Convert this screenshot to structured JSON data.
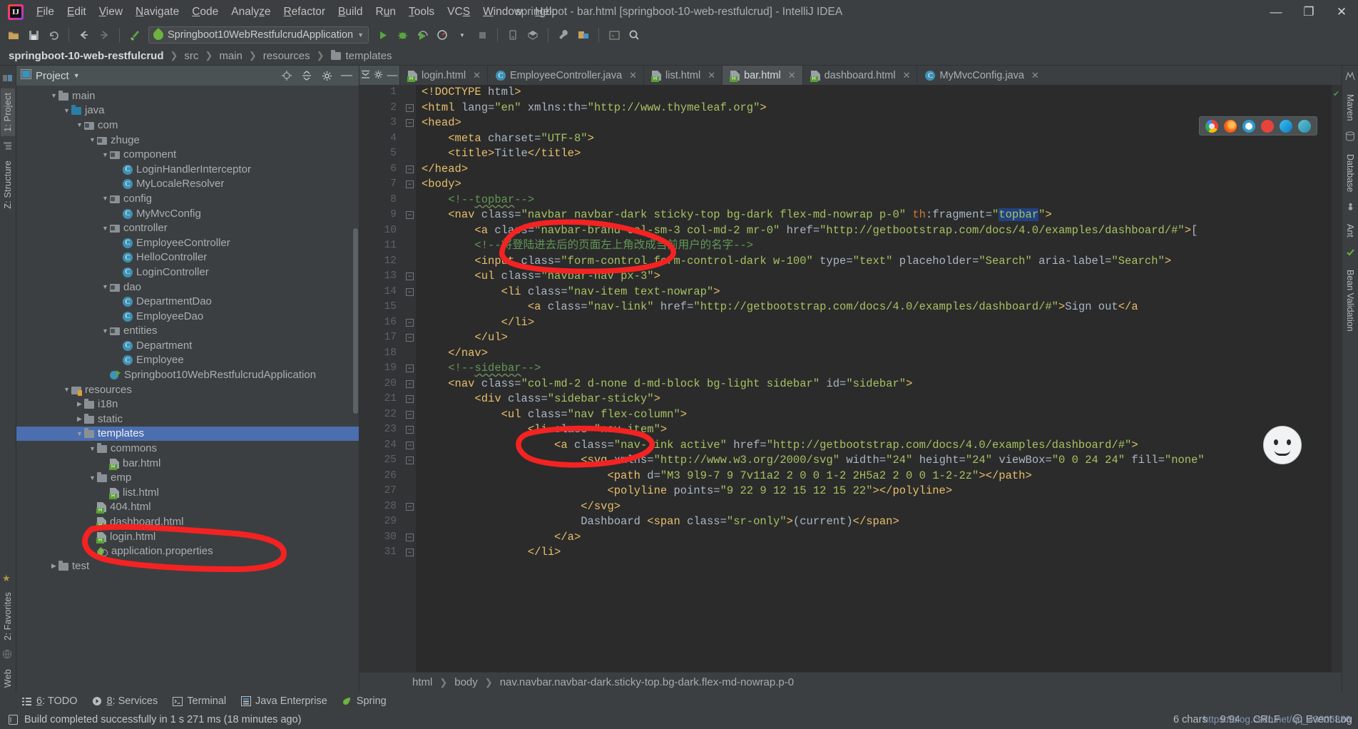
{
  "window": {
    "title": "springboot - bar.html [springboot-10-web-restfulcrud] - IntelliJ IDEA",
    "minimize": "—",
    "maximize": "❐",
    "close": "✕"
  },
  "menu": [
    "File",
    "Edit",
    "View",
    "Navigate",
    "Code",
    "Analyze",
    "Refactor",
    "Build",
    "Run",
    "Tools",
    "VCS",
    "Window",
    "Help"
  ],
  "toolbar": {
    "run_config": "Springboot10WebRestfulcrudApplication",
    "icons": [
      "open-folder-icon",
      "save-icon",
      "sync-icon",
      "back-icon",
      "forward-icon",
      "build-icon",
      "run-icon",
      "debug-icon",
      "coverage-icon",
      "profile-icon",
      "stop-icon",
      "device-manager-icon",
      "sdk-manager-icon",
      "settings-wrench-icon",
      "project-structure-icon",
      "terminal-icon",
      "search-everywhere-icon"
    ]
  },
  "breadcrumb": {
    "project": "springboot-10-web-restfulcrud",
    "items": [
      "src",
      "main",
      "resources"
    ],
    "current": "templates"
  },
  "left_strip": {
    "project_tab": "1: Project",
    "structure_tab": "Z: Structure",
    "favorites_tab": "2: Favorites",
    "web_tab": "Web"
  },
  "right_strip": {
    "maven_tab": "Maven",
    "database_tab": "Database",
    "ant_tab": "Ant",
    "bean_validation_tab": "Bean Validation"
  },
  "project_panel": {
    "title": "Project",
    "header_icons": [
      "locate-icon",
      "collapse-all-icon",
      "gear-icon",
      "hide-icon"
    ],
    "tree": [
      {
        "label": "main",
        "indent": 2,
        "arrow": "down",
        "icon": "folder"
      },
      {
        "label": "java",
        "indent": 3,
        "arrow": "down",
        "icon": "folder-blue"
      },
      {
        "label": "com",
        "indent": 4,
        "arrow": "down",
        "icon": "package"
      },
      {
        "label": "zhuge",
        "indent": 5,
        "arrow": "down",
        "icon": "package"
      },
      {
        "label": "component",
        "indent": 6,
        "arrow": "down",
        "icon": "package"
      },
      {
        "label": "LoginHandlerInterceptor",
        "indent": 7,
        "arrow": "none",
        "icon": "class"
      },
      {
        "label": "MyLocaleResolver",
        "indent": 7,
        "arrow": "none",
        "icon": "class"
      },
      {
        "label": "config",
        "indent": 6,
        "arrow": "down",
        "icon": "package"
      },
      {
        "label": "MyMvcConfig",
        "indent": 7,
        "arrow": "none",
        "icon": "class"
      },
      {
        "label": "controller",
        "indent": 6,
        "arrow": "down",
        "icon": "package"
      },
      {
        "label": "EmployeeController",
        "indent": 7,
        "arrow": "none",
        "icon": "class"
      },
      {
        "label": "HelloController",
        "indent": 7,
        "arrow": "none",
        "icon": "class"
      },
      {
        "label": "LoginController",
        "indent": 7,
        "arrow": "none",
        "icon": "class"
      },
      {
        "label": "dao",
        "indent": 6,
        "arrow": "down",
        "icon": "package"
      },
      {
        "label": "DepartmentDao",
        "indent": 7,
        "arrow": "none",
        "icon": "class"
      },
      {
        "label": "EmployeeDao",
        "indent": 7,
        "arrow": "none",
        "icon": "class"
      },
      {
        "label": "entities",
        "indent": 6,
        "arrow": "down",
        "icon": "package"
      },
      {
        "label": "Department",
        "indent": 7,
        "arrow": "none",
        "icon": "class"
      },
      {
        "label": "Employee",
        "indent": 7,
        "arrow": "none",
        "icon": "class"
      },
      {
        "label": "Springboot10WebRestfulcrudApplication",
        "indent": 6,
        "arrow": "none",
        "icon": "spring-run"
      },
      {
        "label": "resources",
        "indent": 3,
        "arrow": "down",
        "icon": "resources"
      },
      {
        "label": "i18n",
        "indent": 4,
        "arrow": "right",
        "icon": "folder"
      },
      {
        "label": "static",
        "indent": 4,
        "arrow": "right",
        "icon": "folder"
      },
      {
        "label": "templates",
        "indent": 4,
        "arrow": "down",
        "icon": "folder",
        "selected": true
      },
      {
        "label": "commons",
        "indent": 5,
        "arrow": "down",
        "icon": "folder"
      },
      {
        "label": "bar.html",
        "indent": 6,
        "arrow": "none",
        "icon": "html"
      },
      {
        "label": "emp",
        "indent": 5,
        "arrow": "down",
        "icon": "folder"
      },
      {
        "label": "list.html",
        "indent": 6,
        "arrow": "none",
        "icon": "html"
      },
      {
        "label": "404.html",
        "indent": 5,
        "arrow": "none",
        "icon": "html"
      },
      {
        "label": "dashboard.html",
        "indent": 5,
        "arrow": "none",
        "icon": "html"
      },
      {
        "label": "login.html",
        "indent": 5,
        "arrow": "none",
        "icon": "html"
      },
      {
        "label": "application.properties",
        "indent": 5,
        "arrow": "none",
        "icon": "properties"
      },
      {
        "label": "test",
        "indent": 2,
        "arrow": "right",
        "icon": "folder"
      }
    ]
  },
  "editor": {
    "tabs": [
      {
        "label": "login.html",
        "icon": "html-icon",
        "active": false
      },
      {
        "label": "EmployeeController.java",
        "icon": "class-icon",
        "active": false
      },
      {
        "label": "list.html",
        "icon": "html-icon",
        "active": false
      },
      {
        "label": "bar.html",
        "icon": "html-icon",
        "active": true
      },
      {
        "label": "dashboard.html",
        "icon": "html-icon",
        "active": false
      },
      {
        "label": "MyMvcConfig.java",
        "icon": "class-icon",
        "active": false
      }
    ],
    "first_line": 1,
    "lines": [
      "<!DOCTYPE html>",
      "<html lang=\"en\" xmlns:th=\"http://www.thymeleaf.org\">",
      "<head>",
      "    <meta charset=\"UTF-8\">",
      "    <title>Title</title>",
      "</head>",
      "<body>",
      "    <!--topbar-->",
      "    <nav class=\"navbar navbar-dark sticky-top bg-dark flex-md-nowrap p-0\" th:fragment=\"topbar\">",
      "        <a class=\"navbar-brand col-sm-3 col-md-2 mr-0\" href=\"http://getbootstrap.com/docs/4.0/examples/dashboard/#\">[",
      "        <!--将登陆进去后的页面左上角改成当前用户的名字-->",
      "        <input class=\"form-control form-control-dark w-100\" type=\"text\" placeholder=\"Search\" aria-label=\"Search\">",
      "        <ul class=\"navbar-nav px-3\">",
      "            <li class=\"nav-item text-nowrap\">",
      "                <a class=\"nav-link\" href=\"http://getbootstrap.com/docs/4.0/examples/dashboard/#\">Sign out</a",
      "            </li>",
      "        </ul>",
      "    </nav>",
      "    <!--sidebar-->",
      "    <nav class=\"col-md-2 d-none d-md-block bg-light sidebar\" id=\"sidebar\">",
      "        <div class=\"sidebar-sticky\">",
      "            <ul class=\"nav flex-column\">",
      "                <li class=\"nav-item\">",
      "                    <a class=\"nav-link active\" href=\"http://getbootstrap.com/docs/4.0/examples/dashboard/#\">",
      "                        <svg xmlns=\"http://www.w3.org/2000/svg\" width=\"24\" height=\"24\" viewBox=\"0 0 24 24\" fill=\"none\"",
      "                            <path d=\"M3 9l9-7 9 7v11a2 2 0 0 1-2 2H5a2 2 0 0 1-2-2z\"></path>",
      "                            <polyline points=\"9 22 9 12 15 12 15 22\"></polyline>",
      "                        </svg>",
      "                        Dashboard <span class=\"sr-only\">(current)</span>",
      "                    </a>",
      "                </li>"
    ],
    "selected_token": "topbar",
    "breadcrumb": [
      "html",
      "body",
      "nav.navbar.navbar-dark.sticky-top.bg-dark.flex-md-nowrap.p-0"
    ]
  },
  "bottom_tools": [
    {
      "num": "6",
      "label": "TODO",
      "icon": "todo-icon"
    },
    {
      "num": "8",
      "label": "Services",
      "icon": "services-icon"
    },
    {
      "num": "",
      "label": "Terminal",
      "icon": "terminal-icon"
    },
    {
      "num": "",
      "label": "Java Enterprise",
      "icon": "java-enterprise-icon"
    },
    {
      "num": "",
      "label": "Spring",
      "icon": "spring-icon"
    }
  ],
  "status": {
    "message": "Build completed successfully in 1 s 271 ms (18 minutes ago)",
    "chars": "6 chars",
    "caret": "9:94",
    "line_sep": "CRLF",
    "event_log": "Event Log",
    "watermark": "https://blog.csdn.net/qq_43906886"
  },
  "colors": {
    "accent_selection": "#4b6eaf",
    "annotation_red": "#f52222",
    "string_green": "#a5c261",
    "tag_orange": "#e8bf6a",
    "comment_green": "#629755",
    "keyword_orange": "#cc7832"
  }
}
